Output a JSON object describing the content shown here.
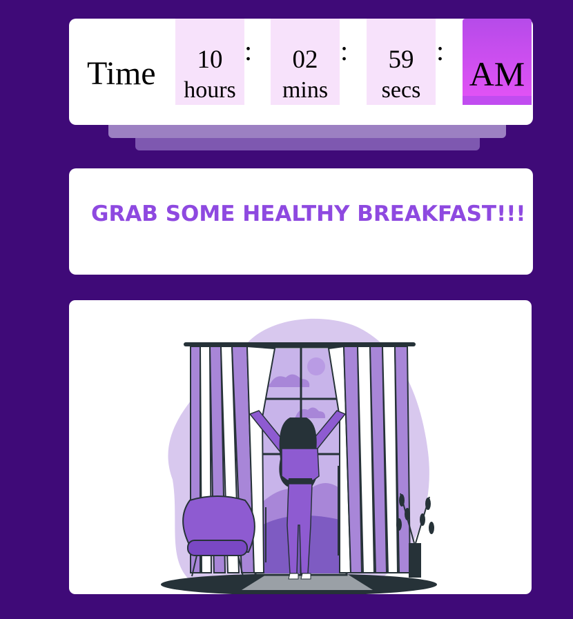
{
  "clock": {
    "label": "Time",
    "hours_value": "10",
    "hours_label": "hours",
    "minutes_value": "02",
    "minutes_label": "mins",
    "seconds_value": "59",
    "seconds_label": "secs",
    "separator": ":",
    "meridiem": "AM"
  },
  "message": {
    "text": "GRAB SOME HEALTHY BREAKFAST!!!"
  },
  "illustration": {
    "subject": "woman-opening-curtains",
    "accent_color": "#8e5bd1",
    "dark_color": "#263238"
  },
  "colors": {
    "background": "#3f0a78",
    "card": "#ffffff",
    "unit_box": "#f7e2fb",
    "message_text": "#8e49e0",
    "ampm_gradient_top": "#b64be9",
    "ampm_gradient_bottom": "#e052f5"
  }
}
